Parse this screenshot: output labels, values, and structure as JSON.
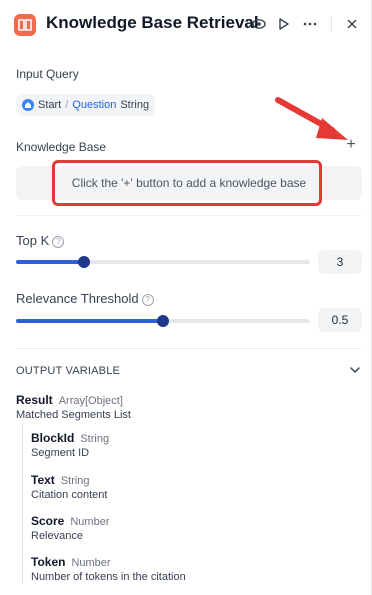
{
  "header": {
    "title": "Knowledge Base Retrieval"
  },
  "input_query": {
    "label": "Input Query",
    "chip": {
      "node": "Start",
      "separator": "/",
      "variable": "Question",
      "type": "String"
    }
  },
  "knowledge_base": {
    "label": "Knowledge Base",
    "add_symbol": "+",
    "empty_hint": "Click the '+' button to add a knowledge base"
  },
  "top_k": {
    "label": "Top K",
    "value": "3",
    "level": 0.23
  },
  "relevance": {
    "label": "Relevance Threshold",
    "value": "0.5",
    "level": 0.5
  },
  "output": {
    "title": "OUTPUT VARIABLE",
    "result": {
      "name": "Result",
      "type": "Array[Object]",
      "desc": "Matched Segments List"
    },
    "fields": [
      {
        "name": "BlockId",
        "type": "String",
        "desc": "Segment ID"
      },
      {
        "name": "Text",
        "type": "String",
        "desc": "Citation content"
      },
      {
        "name": "Score",
        "type": "Number",
        "desc": "Relevance"
      },
      {
        "name": "Token",
        "type": "Number",
        "desc": "Number of tokens in the citation"
      }
    ]
  },
  "colors": {
    "accent": "#2f5fd8",
    "brand": "#f26b4a",
    "annotation": "#e53935"
  }
}
